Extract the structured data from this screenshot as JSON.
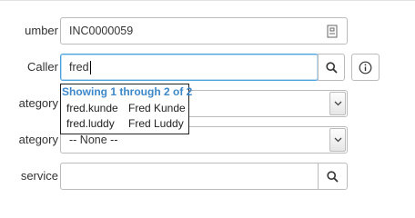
{
  "form": {
    "number": {
      "label": "umber",
      "value": "INC0000059"
    },
    "caller": {
      "label": "Caller",
      "value": "fred"
    },
    "category": {
      "label": "ategory",
      "value": ""
    },
    "subcategory": {
      "label": "ategory",
      "value": "-- None --"
    },
    "service": {
      "label": "service",
      "value": ""
    }
  },
  "autocomplete": {
    "header": "Showing 1 through 2 of 2",
    "results": [
      {
        "user_id": "fred.kunde",
        "name": "Fred Kunde"
      },
      {
        "user_id": "fred.luddy",
        "name": "Fred Luddy"
      }
    ]
  },
  "icons": {
    "number_addon": "document-icon",
    "caller_lookup": "search-icon",
    "caller_info": "info-icon",
    "select_arrow": "chevron-down-icon",
    "service_lookup": "search-icon"
  },
  "colors": {
    "focus_border": "#4aa3df",
    "dropdown_header": "#3d88c9"
  }
}
